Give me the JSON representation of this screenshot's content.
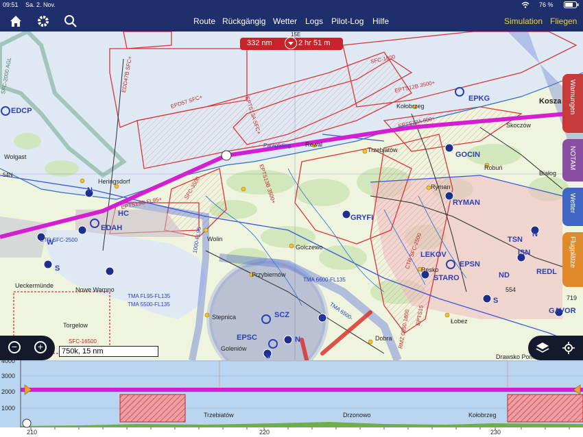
{
  "status": {
    "time": "09:51",
    "date": "Sa. 2. Nov.",
    "battery": "76 %"
  },
  "navbar": {
    "items": [
      "Route",
      "Rückgängig",
      "Wetter",
      "Logs",
      "Pilot-Log",
      "Hilfe"
    ],
    "simulation": "Simulation",
    "fly": "Fliegen"
  },
  "route": {
    "distance": "332 nm",
    "duration": "2 hr 51 m"
  },
  "side_tabs": [
    "Warnungen",
    "NOTAM",
    "Wetter",
    "Flugplätze"
  ],
  "side_tab_colors": [
    "#c73a3a",
    "#8a4fa3",
    "#3f66c2",
    "#e08a2c"
  ],
  "scale": "750k, 15 nm",
  "map_labels": {
    "edcp": "EDCP",
    "wolgast": "Wolgast",
    "heringsdorf": "Heringsdorf",
    "edah": "EDAH",
    "hc": "HC",
    "n1": "N",
    "w": "W",
    "s1": "S",
    "ueckermuende": "Ueckermünde",
    "nowewarpno": "Nowe Warpno",
    "torgelow": "Torgelow",
    "sfc16500": "SFC-16500",
    "ctr": "CTR SFC-2500",
    "wolin": "Wolin",
    "golczewo": "Golczewo",
    "przybiernow": "Przybiernów",
    "stepnica": "Stepnica",
    "scz": "SCZ",
    "epsc": "EPSC",
    "goleniow": "Goleniów",
    "s2": "S",
    "n2": "N",
    "r": "R",
    "dobra": "Dobra",
    "tma6600": "TMA 6600-FL135",
    "tmafl95": "TMA FL95-FL135",
    "tma5500": "TMA 5500-FL135",
    "tma6500": "TMA 6500-",
    "gryfi": "GRYFI",
    "resko": "Resko",
    "lobez": "Łobez",
    "staro": "STARO",
    "lekov": "LEKOV",
    "ryman": "RYMAN",
    "rymanTown": "Ryman",
    "gocin": "GOCIN",
    "trzebiatow": "Trzebiatów",
    "rewal": "Rewal",
    "paragliding": "Paragliding",
    "kolobrzeg": "Kołobrzeg",
    "epkg": "EPKG",
    "skoczow": "Skoczów",
    "robun": "Robuń",
    "koszalin": "Kosza",
    "bialogard": "Białog",
    "epsn": "EPSN",
    "isn": "ISN",
    "tsn": "TSN",
    "nd": "ND",
    "s3": "S",
    "n3": "N",
    "redl": "REDL",
    "gavor": "GAVOR",
    "v554": "554",
    "v719": "719",
    "drawsko": "Drawsko Pomorskie",
    "ed47b": "EDD47B SFC+",
    "epd57": "EPD57 SFC+",
    "epts13a": "EPTS13A SFC+",
    "epts12b": "EPTS12B 3500+",
    "epts12a": "EPTS12A 900+",
    "epts13b": "EPTS13B 3500+",
    "epts13c": "EPTS13C FL95+",
    "sfc1800": "SFC-1800",
    "sfc2000": "SFC-2000 AGL",
    "n54": "54N",
    "e15": "15E",
    "sfc3500": "SFC-3500",
    "sfc1000": "1000-FL95",
    "ctr2500b": "CTR SFC-2500",
    "rmz": "RMZ 0050-1800",
    "epts15": "EPTS15"
  },
  "profile": {
    "alt_labels": [
      "4000",
      "3000",
      "2000",
      "1000"
    ],
    "x_labels": [
      "210",
      "220",
      "230"
    ],
    "towns": [
      "Trzebiatów",
      "Drzonowo",
      "Kołobrzeg"
    ]
  }
}
